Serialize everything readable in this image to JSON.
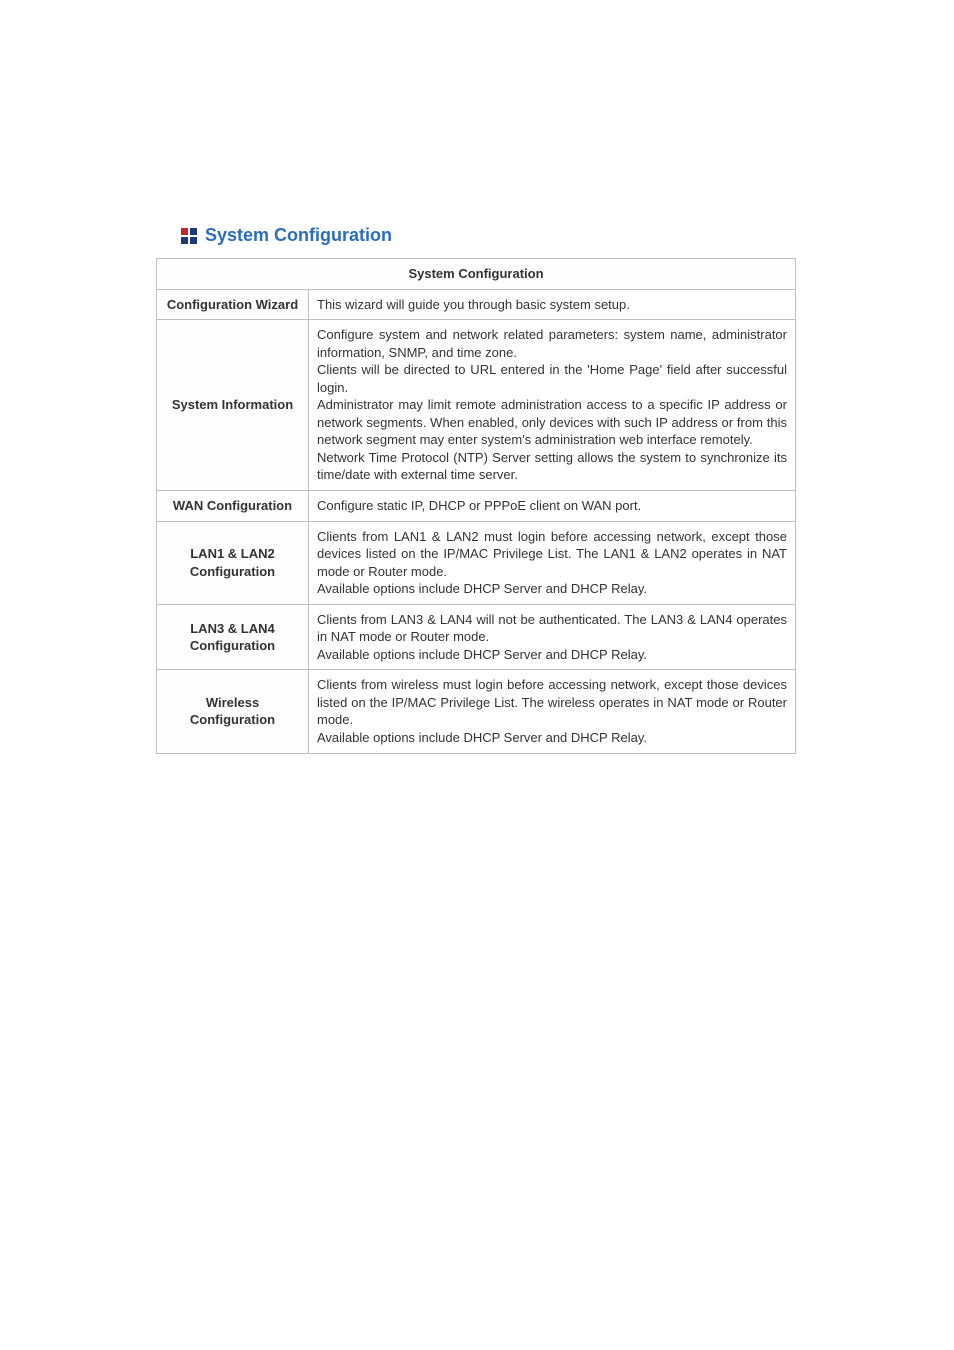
{
  "heading": "System Configuration",
  "table": {
    "title": "System Configuration",
    "rows": [
      {
        "label": "Configuration Wizard",
        "desc": "This wizard will guide you through basic system setup."
      },
      {
        "label": "System Information",
        "desc_lines": [
          "Configure system and network related parameters: system name, administrator information, SNMP, and time zone.",
          "Clients will be directed to URL entered in the 'Home Page' field after successful login.",
          "Administrator may limit remote administration access to a specific IP address or network segments. When enabled, only devices with such IP address or from this network segment may enter system's administration web interface remotely.",
          "Network Time Protocol (NTP) Server setting allows the system to synchronize its time/date with external time server."
        ]
      },
      {
        "label": "WAN Configuration",
        "desc": "Configure static IP, DHCP or PPPoE client on WAN port."
      },
      {
        "label": "LAN1 & LAN2 Configuration",
        "desc_lines": [
          "Clients from LAN1 & LAN2 must login before accessing network, except those devices listed on the IP/MAC Privilege List. The LAN1 & LAN2 operates in NAT mode or Router mode.",
          "Available options include DHCP Server and DHCP Relay."
        ]
      },
      {
        "label": "LAN3 & LAN4 Configuration",
        "desc_lines": [
          "Clients from LAN3 & LAN4 will not be authenticated. The LAN3 & LAN4 operates in NAT mode or Router mode.",
          "Available options include DHCP Server and DHCP Relay."
        ]
      },
      {
        "label": "Wireless Configuration",
        "desc_lines": [
          "Clients from wireless must login before accessing network, except those devices listed on the IP/MAC Privilege List. The wireless operates in NAT mode or Router mode.",
          "Available options include DHCP Server and DHCP Relay."
        ]
      }
    ]
  }
}
